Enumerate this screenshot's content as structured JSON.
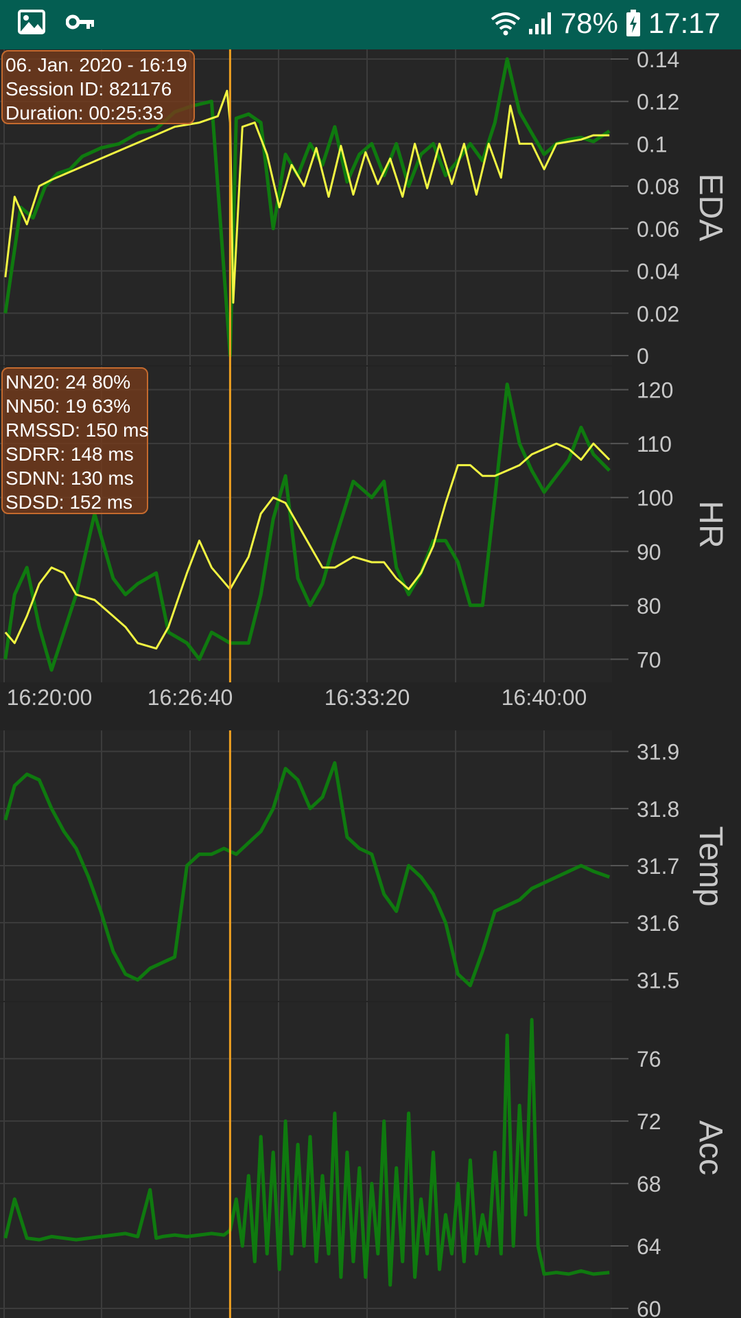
{
  "status_bar": {
    "battery_percent": "78%",
    "time": "17:17",
    "icons": [
      "image-icon",
      "key-icon",
      "wifi-icon",
      "signal-icon",
      "battery-charging-icon"
    ]
  },
  "session_info": {
    "date": "06. Jan. 2020 - 16:19",
    "session_id": "Session ID: 821176",
    "duration": "Duration: 00:25:33"
  },
  "hrv_stats": {
    "nn20": "NN20: 24 80%",
    "nn50": "NN50: 19 63%",
    "rmssd": "RMSSD: 150 ms",
    "sdrr": "SDRR: 148 ms",
    "sdnn": "SDNN: 130 ms",
    "sdsd": "SDSD: 152 ms"
  },
  "colors": {
    "background": "#232323",
    "grid": "#3c3c3c",
    "raw_series": "#0f7a0f",
    "smoothed_series": "#f2f542",
    "cursor": "#f0a020",
    "axis_text": "#c8c8c8",
    "status_bar": "#045e52"
  },
  "chart_data": [
    {
      "type": "line",
      "ylabel": "EDA",
      "ytick_labels": [
        "0",
        "0.02",
        "0.04",
        "0.06",
        "0.08",
        "0.1",
        "0.12",
        "0.14"
      ],
      "ylim": [
        0,
        0.14
      ],
      "x_unit": "minutes",
      "xlim": [
        16.83,
        26.68
      ],
      "series": [
        {
          "style": "raw",
          "x": [
            16.85,
            17.1,
            17.3,
            17.5,
            17.7,
            17.9,
            18.1,
            18.4,
            18.7,
            19.0,
            19.3,
            19.6,
            19.9,
            20.2,
            20.5,
            20.6,
            20.8,
            21.0,
            21.2,
            21.4,
            21.6,
            21.8,
            22.0,
            22.2,
            22.4,
            22.6,
            22.8,
            23.0,
            23.2,
            23.4,
            23.6,
            23.8,
            24.0,
            24.2,
            24.4,
            24.6,
            24.8,
            25.0,
            25.2,
            25.4,
            25.6,
            25.8,
            26.0,
            26.2,
            26.4,
            26.66
          ],
          "y": [
            0.02,
            0.07,
            0.065,
            0.08,
            0.086,
            0.088,
            0.094,
            0.098,
            0.1,
            0.105,
            0.107,
            0.115,
            0.118,
            0.12,
            0.0,
            0.112,
            0.114,
            0.11,
            0.06,
            0.095,
            0.085,
            0.1,
            0.09,
            0.108,
            0.082,
            0.095,
            0.1,
            0.085,
            0.1,
            0.08,
            0.095,
            0.1,
            0.085,
            0.092,
            0.1,
            0.092,
            0.11,
            0.14,
            0.115,
            0.105,
            0.095,
            0.1,
            0.102,
            0.103,
            0.101,
            0.106
          ]
        },
        {
          "style": "smoothed",
          "x": [
            16.85,
            17.0,
            17.2,
            17.4,
            17.6,
            18.0,
            18.4,
            18.8,
            19.2,
            19.6,
            20.0,
            20.3,
            20.45,
            20.5,
            20.55,
            20.7,
            20.9,
            21.1,
            21.3,
            21.5,
            21.7,
            21.9,
            22.1,
            22.3,
            22.5,
            22.7,
            22.9,
            23.1,
            23.3,
            23.5,
            23.7,
            23.9,
            24.1,
            24.3,
            24.5,
            24.7,
            24.9,
            25.05,
            25.2,
            25.4,
            25.6,
            25.8,
            26.0,
            26.2,
            26.4,
            26.66
          ],
          "y": [
            0.037,
            0.075,
            0.062,
            0.08,
            0.083,
            0.088,
            0.093,
            0.098,
            0.103,
            0.108,
            0.11,
            0.113,
            0.125,
            0.11,
            0.025,
            0.108,
            0.11,
            0.095,
            0.07,
            0.09,
            0.08,
            0.098,
            0.075,
            0.099,
            0.076,
            0.096,
            0.081,
            0.093,
            0.075,
            0.1,
            0.079,
            0.1,
            0.081,
            0.1,
            0.076,
            0.1,
            0.084,
            0.118,
            0.1,
            0.1,
            0.088,
            0.1,
            0.101,
            0.102,
            0.104,
            0.104
          ]
        }
      ]
    },
    {
      "type": "line",
      "ylabel": "HR",
      "ytick_labels": [
        "70",
        "80",
        "90",
        "100",
        "110",
        "120"
      ],
      "ylim": [
        67.5,
        122.5
      ],
      "x_unit": "minutes",
      "xlim": [
        16.83,
        26.68
      ],
      "xtick_labels": [
        "16:20:00",
        "16:26:40",
        "16:33:20",
        "16:40:00"
      ],
      "xtick_values": [
        17.67,
        24.33,
        31.0,
        37.67
      ],
      "cursor_x": 20.5,
      "series": [
        {
          "style": "raw",
          "x": [
            16.85,
            17.0,
            17.2,
            17.4,
            17.6,
            17.8,
            18.0,
            18.3,
            18.6,
            18.8,
            19.0,
            19.3,
            19.5,
            19.8,
            20.0,
            20.2,
            20.5,
            20.8,
            21.0,
            21.2,
            21.4,
            21.6,
            21.8,
            22.0,
            22.2,
            22.5,
            22.8,
            23.0,
            23.2,
            23.4,
            23.6,
            23.8,
            24.0,
            24.2,
            24.4,
            24.6,
            24.8,
            25.0,
            25.2,
            25.4,
            25.6,
            25.8,
            26.0,
            26.2,
            26.4,
            26.66
          ],
          "y": [
            70,
            82,
            87,
            76,
            68,
            75,
            82,
            97,
            85,
            82,
            84,
            86,
            75,
            73,
            70,
            75,
            73,
            73,
            82,
            96,
            104,
            85,
            80,
            84,
            92,
            103,
            100,
            103,
            87,
            82,
            86,
            92,
            92,
            88,
            80,
            80,
            100,
            121,
            110,
            105,
            101,
            104,
            107,
            113,
            108,
            105
          ]
        },
        {
          "style": "smoothed",
          "x": [
            16.85,
            17.0,
            17.2,
            17.4,
            17.6,
            17.8,
            18.0,
            18.3,
            18.6,
            18.8,
            19.0,
            19.3,
            19.5,
            19.8,
            20.0,
            20.2,
            20.5,
            20.8,
            21.0,
            21.2,
            21.4,
            21.6,
            21.8,
            22.0,
            22.2,
            22.5,
            22.8,
            23.0,
            23.2,
            23.4,
            23.6,
            23.8,
            24.0,
            24.2,
            24.4,
            24.6,
            24.8,
            25.0,
            25.2,
            25.4,
            25.6,
            25.8,
            26.0,
            26.2,
            26.4,
            26.66
          ],
          "y": [
            75,
            73,
            78,
            84,
            87,
            86,
            82,
            81,
            78,
            76,
            73,
            72,
            76,
            86,
            92,
            87,
            83,
            89,
            97,
            100,
            99,
            95,
            91,
            87,
            87,
            89,
            88,
            88,
            85,
            83,
            86,
            91,
            99,
            106,
            106,
            104,
            104,
            105,
            106,
            108,
            109,
            110,
            109,
            107,
            110,
            107
          ]
        }
      ]
    },
    {
      "type": "line",
      "ylabel": "Temp",
      "ytick_labels": [
        "31.5",
        "31.6",
        "31.7",
        "31.8",
        "31.9"
      ],
      "ylim": [
        31.48,
        31.92
      ],
      "x_unit": "minutes",
      "xlim": [
        16.83,
        26.68
      ],
      "series": [
        {
          "style": "raw",
          "x": [
            16.85,
            17.0,
            17.2,
            17.4,
            17.6,
            17.8,
            18.0,
            18.2,
            18.4,
            18.6,
            18.8,
            19.0,
            19.2,
            19.4,
            19.6,
            19.8,
            20.0,
            20.2,
            20.4,
            20.6,
            20.8,
            21.0,
            21.2,
            21.4,
            21.6,
            21.8,
            22.0,
            22.2,
            22.4,
            22.6,
            22.8,
            23.0,
            23.2,
            23.4,
            23.6,
            23.8,
            24.0,
            24.2,
            24.4,
            24.6,
            24.8,
            25.0,
            25.2,
            25.4,
            25.6,
            25.8,
            26.0,
            26.2,
            26.4,
            26.66
          ],
          "y": [
            31.78,
            31.84,
            31.86,
            31.85,
            31.8,
            31.76,
            31.73,
            31.68,
            31.62,
            31.55,
            31.51,
            31.5,
            31.52,
            31.53,
            31.54,
            31.7,
            31.72,
            31.72,
            31.73,
            31.72,
            31.74,
            31.76,
            31.8,
            31.87,
            31.85,
            31.8,
            31.82,
            31.88,
            31.75,
            31.73,
            31.72,
            31.65,
            31.62,
            31.7,
            31.68,
            31.65,
            31.6,
            31.51,
            31.49,
            31.55,
            31.62,
            31.63,
            31.64,
            31.66,
            31.67,
            31.68,
            31.69,
            31.7,
            31.69,
            31.68
          ]
        }
      ]
    },
    {
      "type": "line",
      "ylabel": "Acc",
      "ytick_labels": [
        "60",
        "64",
        "68",
        "72",
        "76"
      ],
      "ylim": [
        60,
        79
      ],
      "x_unit": "minutes",
      "xlim": [
        16.83,
        26.68
      ],
      "series": [
        {
          "style": "raw",
          "x": [
            16.85,
            17.0,
            17.2,
            17.4,
            17.6,
            17.8,
            18.0,
            18.2,
            18.4,
            18.6,
            18.8,
            19.0,
            19.2,
            19.3,
            19.4,
            19.6,
            19.8,
            20.0,
            20.2,
            20.4,
            20.5,
            20.6,
            20.7,
            20.8,
            20.9,
            21.0,
            21.1,
            21.2,
            21.3,
            21.4,
            21.5,
            21.6,
            21.7,
            21.8,
            21.9,
            22.0,
            22.1,
            22.2,
            22.3,
            22.4,
            22.5,
            22.6,
            22.7,
            22.8,
            22.9,
            23.0,
            23.1,
            23.2,
            23.3,
            23.4,
            23.5,
            23.6,
            23.7,
            23.8,
            23.9,
            24.0,
            24.1,
            24.2,
            24.3,
            24.4,
            24.5,
            24.6,
            24.7,
            24.8,
            24.9,
            25.0,
            25.1,
            25.2,
            25.3,
            25.4,
            25.5,
            25.6,
            25.8,
            26.0,
            26.2,
            26.4,
            26.66
          ],
          "y": [
            64.5,
            67,
            64.5,
            64.4,
            64.6,
            64.5,
            64.4,
            64.5,
            64.6,
            64.7,
            64.8,
            64.6,
            67.6,
            64.5,
            64.6,
            64.7,
            64.6,
            64.7,
            64.8,
            64.7,
            65,
            67,
            64,
            68.5,
            63,
            71,
            63.5,
            70,
            62.5,
            72,
            63.5,
            70.5,
            64,
            71,
            63,
            68.5,
            63.5,
            72.5,
            62,
            70,
            63,
            69,
            62,
            68,
            63.5,
            72,
            61.5,
            69,
            63,
            72.5,
            62,
            67,
            63.5,
            70,
            62.5,
            66,
            63.5,
            68,
            63,
            69.5,
            63.5,
            66,
            64,
            70,
            63.5,
            77.5,
            64,
            73,
            66,
            78.5,
            64,
            62.2,
            62.3,
            62.2,
            62.4,
            62.2,
            62.3
          ]
        }
      ]
    }
  ]
}
